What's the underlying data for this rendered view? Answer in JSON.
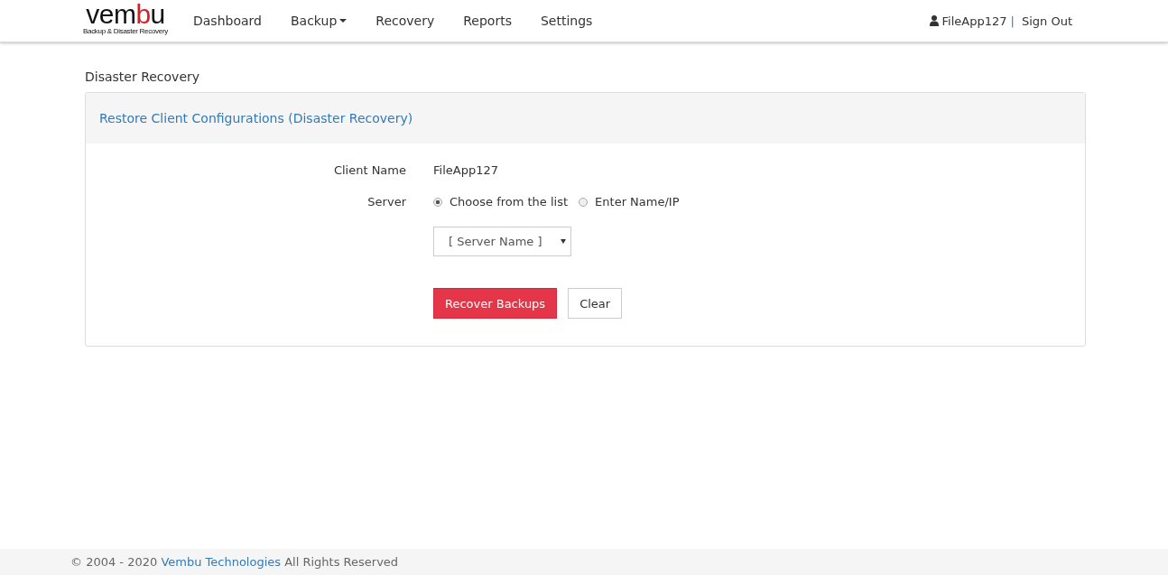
{
  "logo": {
    "parts": [
      {
        "text": "vem",
        "accent": false
      },
      {
        "text": "b",
        "accent": true
      },
      {
        "text": "u",
        "accent": false
      }
    ],
    "tagline": "Backup & Disaster Recovery"
  },
  "nav": [
    {
      "label": "Dashboard",
      "kind": "link",
      "selected": false
    },
    {
      "label": "Backup",
      "kind": "dropdown",
      "selected": false
    },
    {
      "label": "Recovery",
      "kind": "link",
      "selected": false
    },
    {
      "label": "Reports",
      "kind": "link",
      "selected": false
    },
    {
      "label": "Settings",
      "kind": "link",
      "selected": false
    }
  ],
  "user": {
    "name": "FileApp127",
    "separator": "|",
    "sign_out": "Sign Out"
  },
  "page_title": "Disaster Recovery",
  "panel": {
    "heading": "Restore Client Configurations (Disaster Recovery)",
    "client_label": "Client Name",
    "client_value": "FileApp127",
    "server_label": "Server",
    "server_options": [
      {
        "label": "Choose from the list",
        "selected": true
      },
      {
        "label": "Enter Name/IP",
        "selected": false
      }
    ],
    "server_select": {
      "value": "[ Server Name ]"
    },
    "buttons": [
      {
        "label": "Recover Backups",
        "kind": "primary"
      },
      {
        "label": "Clear",
        "kind": "default"
      }
    ]
  },
  "footer": {
    "prefix": "© 2004 - 2020",
    "link": "Vembu Technologies",
    "suffix": "All Rights Reserved"
  }
}
